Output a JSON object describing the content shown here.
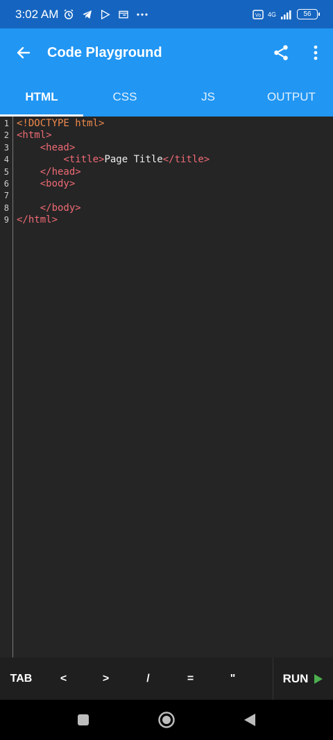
{
  "status_bar": {
    "time": "3:02 AM",
    "network": "4G",
    "battery": "56"
  },
  "app_bar": {
    "title": "Code Playground",
    "back_icon": "arrow-back-icon",
    "share_icon": "share-icon",
    "more_icon": "more-vert-icon"
  },
  "tabs": [
    {
      "label": "HTML",
      "active": true
    },
    {
      "label": "CSS",
      "active": false
    },
    {
      "label": "JS",
      "active": false
    },
    {
      "label": "OUTPUT",
      "active": false
    }
  ],
  "editor": {
    "line_numbers": [
      "1",
      "2",
      "3",
      "4",
      "5",
      "6",
      "7",
      "8",
      "9"
    ],
    "lines": [
      [
        {
          "t": "doctype",
          "v": "<!DOCTYPE html>"
        }
      ],
      [
        {
          "t": "tag",
          "v": "<html>"
        }
      ],
      [
        {
          "t": "text",
          "v": "    "
        },
        {
          "t": "tag",
          "v": "<head>"
        }
      ],
      [
        {
          "t": "text",
          "v": "        "
        },
        {
          "t": "tag",
          "v": "<title>"
        },
        {
          "t": "text",
          "v": "Page Title"
        },
        {
          "t": "tag",
          "v": "</title>"
        }
      ],
      [
        {
          "t": "text",
          "v": "    "
        },
        {
          "t": "tag",
          "v": "</head>"
        }
      ],
      [
        {
          "t": "text",
          "v": "    "
        },
        {
          "t": "tag",
          "v": "<body>"
        }
      ],
      [
        {
          "t": "text",
          "v": ""
        }
      ],
      [
        {
          "t": "text",
          "v": "    "
        },
        {
          "t": "tag",
          "v": "</body>"
        }
      ],
      [
        {
          "t": "tag",
          "v": "</html>"
        }
      ]
    ]
  },
  "keybar": {
    "keys": [
      "TAB",
      "<",
      ">",
      "/",
      "=",
      "\""
    ],
    "run_label": "RUN"
  },
  "colors": {
    "status_bar": "#1565c0",
    "app_bar": "#2196f3",
    "editor_bg": "#252526",
    "tag": "#ef6b73",
    "doctype": "#f08a4b",
    "run_icon": "#4caf50"
  }
}
